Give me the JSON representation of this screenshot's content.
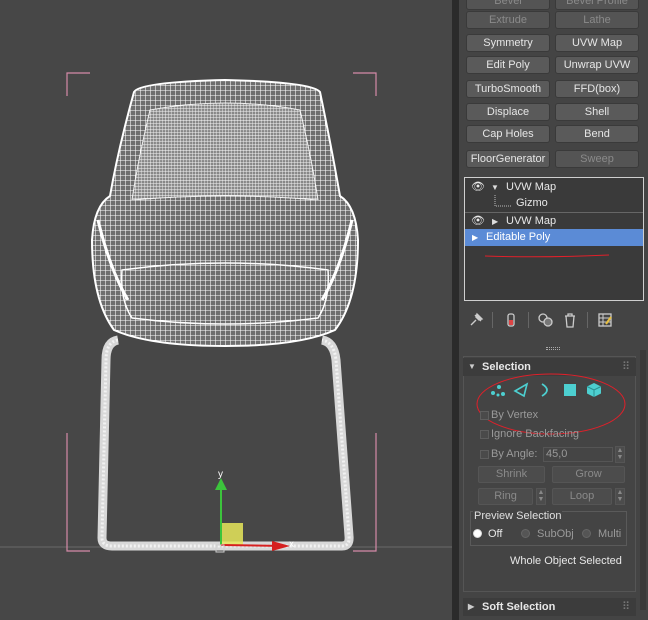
{
  "modifier_buttons": [
    {
      "label": "Bevel",
      "enabled": false
    },
    {
      "label": "Bevel Profile",
      "enabled": false
    },
    {
      "label": "Extrude",
      "enabled": false
    },
    {
      "label": "Lathe",
      "enabled": false
    },
    {
      "label": "Symmetry",
      "enabled": true
    },
    {
      "label": "UVW Map",
      "enabled": true
    },
    {
      "label": "Edit Poly",
      "enabled": true
    },
    {
      "label": "Unwrap UVW",
      "enabled": true
    },
    {
      "label": "TurboSmooth",
      "enabled": true
    },
    {
      "label": "FFD(box)",
      "enabled": true
    },
    {
      "label": "Displace",
      "enabled": true
    },
    {
      "label": "Shell",
      "enabled": true
    },
    {
      "label": "Cap Holes",
      "enabled": true
    },
    {
      "label": "Bend",
      "enabled": true
    },
    {
      "label": "FloorGenerator",
      "enabled": true
    },
    {
      "label": "Sweep",
      "enabled": false
    }
  ],
  "modifier_stack": [
    {
      "label": "UVW Map",
      "visible": true,
      "expanded": true
    },
    {
      "label": "Gizmo",
      "sub": true
    },
    {
      "label": "UVW Map",
      "visible": true,
      "expanded": false
    },
    {
      "label": "Editable Poly",
      "selected": true
    }
  ],
  "stack_toolbar_icons": [
    "pin-stack-icon",
    "show-end-result-icon",
    "make-unique-icon",
    "remove-modifier-icon",
    "configure-sets-icon"
  ],
  "selection_rollout": {
    "title": "Selection",
    "subobject_icons": [
      "vertex-icon",
      "edge-icon",
      "border-icon",
      "polygon-icon",
      "element-icon"
    ],
    "by_vertex": "By Vertex",
    "ignore_backfacing": "Ignore Backfacing",
    "by_angle": "By Angle:",
    "angle_value": "45,0",
    "shrink": "Shrink",
    "grow": "Grow",
    "ring": "Ring",
    "loop": "Loop",
    "preview_selection": "Preview Selection",
    "preview_options": [
      "Off",
      "SubObj",
      "Multi"
    ],
    "preview_selected": "Off",
    "status": "Whole Object Selected"
  },
  "soft_selection_rollout": {
    "title": "Soft Selection"
  },
  "viewport": {
    "axis_x": "x",
    "axis_y": "y",
    "annotation_color": "#e0202a",
    "accent_color": "#5b8bd6"
  }
}
